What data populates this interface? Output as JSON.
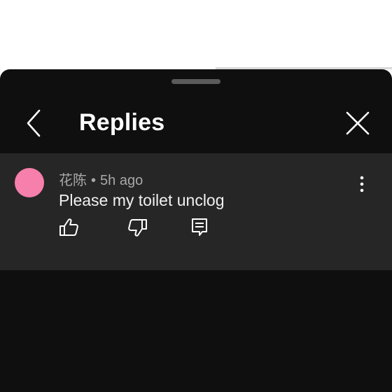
{
  "header": {
    "title": "Replies",
    "back_icon": "chevron-left-icon",
    "close_icon": "close-icon"
  },
  "video_progress": {
    "fraction": 0.55
  },
  "comment": {
    "author": "花陈",
    "separator": "•",
    "time": "5h ago",
    "text": "Please my toilet unclog",
    "avatar_color": "#f77fac",
    "actions": {
      "like_icon": "thumbs-up-icon",
      "dislike_icon": "thumbs-down-icon",
      "reply_icon": "comment-icon",
      "more_icon": "more-vertical-icon"
    }
  },
  "colors": {
    "sheet_background": "#0f0f0f",
    "comment_background": "#262626",
    "primary_text": "#ffffff",
    "secondary_text": "#a8a8a8"
  }
}
